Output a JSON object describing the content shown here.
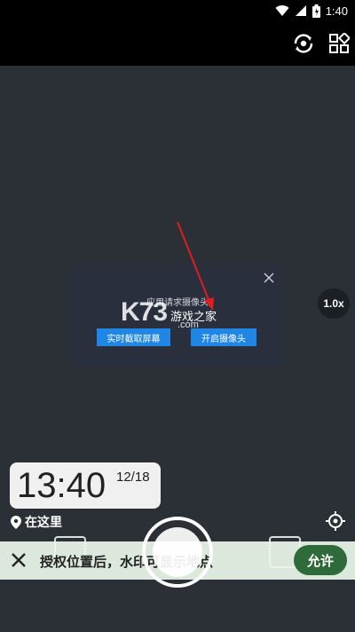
{
  "status_bar": {
    "time": "1:40",
    "icons": [
      "wifi-icon",
      "signal-icon",
      "battery-icon"
    ]
  },
  "top_bar": {
    "icons": [
      "camera-switch-icon",
      "grid-apps-icon"
    ]
  },
  "dialog": {
    "title": "应用请求摄像头",
    "close_icon": "close-icon",
    "buttons": [
      {
        "label": "实时截取屏幕"
      },
      {
        "label": "开启摄像头"
      }
    ]
  },
  "watermark": {
    "logo": "K73",
    "text": "游戏之家",
    "domain": ".com"
  },
  "zoom": {
    "label": "1.0x"
  },
  "time_card": {
    "time": "13:40",
    "date": "12/18"
  },
  "location": {
    "label": "在这里",
    "icon": "location-pin-icon"
  },
  "target_icon": "target-icon",
  "banner": {
    "message": "授权位置后，水印可显示地点",
    "allow_label": "允许",
    "close_icon": "close-icon"
  },
  "colors": {
    "accent_blue": "#1f86e6",
    "allow_green": "#2f6b3a",
    "arrow_red": "#e11d1d"
  }
}
